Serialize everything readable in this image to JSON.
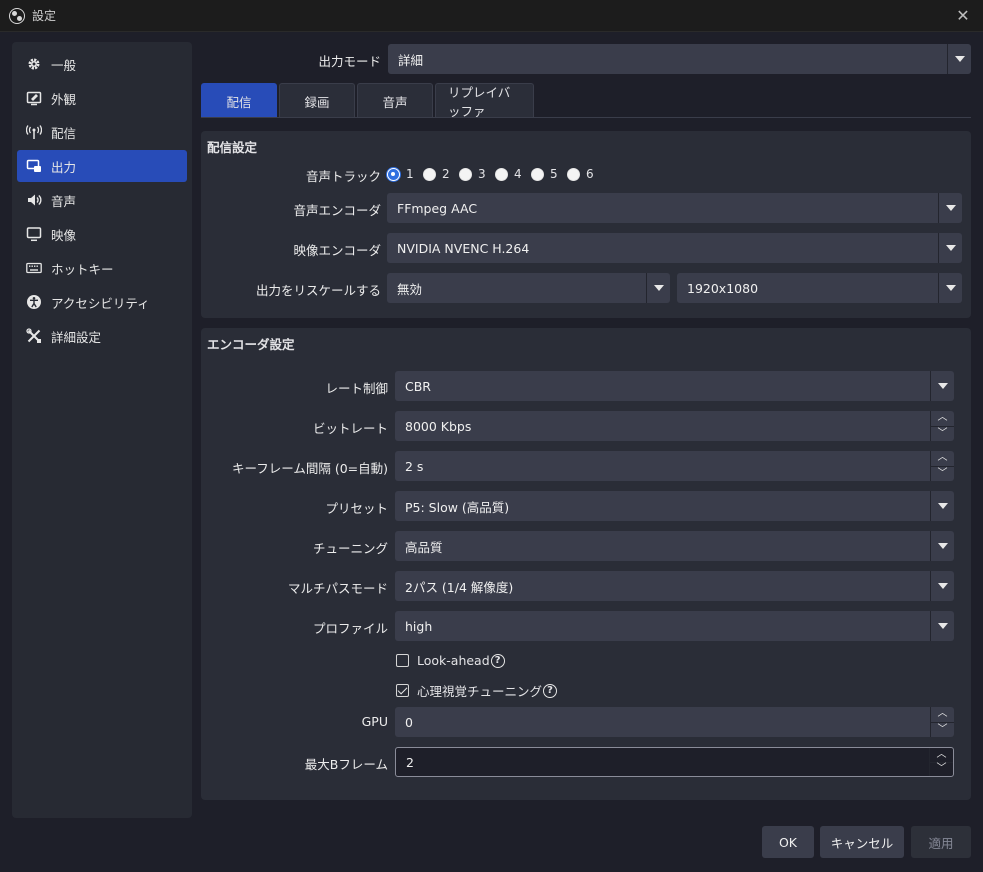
{
  "window": {
    "title": "設定"
  },
  "sidebar": {
    "items": [
      {
        "label": "一般",
        "icon": "gear-icon"
      },
      {
        "label": "外観",
        "icon": "appearance-icon"
      },
      {
        "label": "配信",
        "icon": "broadcast-icon"
      },
      {
        "label": "出力",
        "icon": "output-icon",
        "active": true
      },
      {
        "label": "音声",
        "icon": "speaker-icon"
      },
      {
        "label": "映像",
        "icon": "monitor-icon"
      },
      {
        "label": "ホットキー",
        "icon": "keyboard-icon"
      },
      {
        "label": "アクセシビリティ",
        "icon": "accessibility-icon"
      },
      {
        "label": "詳細設定",
        "icon": "tools-icon"
      }
    ]
  },
  "output_mode": {
    "label": "出力モード",
    "value": "詳細"
  },
  "tabs": [
    "配信",
    "録画",
    "音声",
    "リプレイバッファ"
  ],
  "stream_settings": {
    "title": "配信設定",
    "audio_track": {
      "label": "音声トラック",
      "options": [
        "1",
        "2",
        "3",
        "4",
        "5",
        "6"
      ],
      "selected": "1"
    },
    "audio_encoder": {
      "label": "音声エンコーダ",
      "value": "FFmpeg AAC"
    },
    "video_encoder": {
      "label": "映像エンコーダ",
      "value": "NVIDIA NVENC H.264"
    },
    "rescale": {
      "label": "出力をリスケールする",
      "value": "無効",
      "resolution": "1920x1080"
    }
  },
  "encoder_settings": {
    "title": "エンコーダ設定",
    "rate_control": {
      "label": "レート制御",
      "value": "CBR"
    },
    "bitrate": {
      "label": "ビットレート",
      "value": "8000 Kbps"
    },
    "keyframe": {
      "label": "キーフレーム間隔 (0=自動)",
      "value": "2 s"
    },
    "preset": {
      "label": "プリセット",
      "value": "P5: Slow (高品質)"
    },
    "tuning": {
      "label": "チューニング",
      "value": "高品質"
    },
    "multipass": {
      "label": "マルチパスモード",
      "value": "2パス (1/4 解像度)"
    },
    "profile": {
      "label": "プロファイル",
      "value": "high"
    },
    "lookahead": {
      "label": "Look-ahead",
      "checked": false
    },
    "psycho_visual": {
      "label": "心理視覚チューニング",
      "checked": true
    },
    "gpu": {
      "label": "GPU",
      "value": "0"
    },
    "max_bframes": {
      "label": "最大Bフレーム",
      "value": "2"
    }
  },
  "buttons": {
    "ok": "OK",
    "cancel": "キャンセル",
    "apply": "適用"
  },
  "colors": {
    "accent": "#284cb8",
    "background": "#1e1f29",
    "panel": "#2a2d37",
    "control": "#3a3d4b"
  }
}
